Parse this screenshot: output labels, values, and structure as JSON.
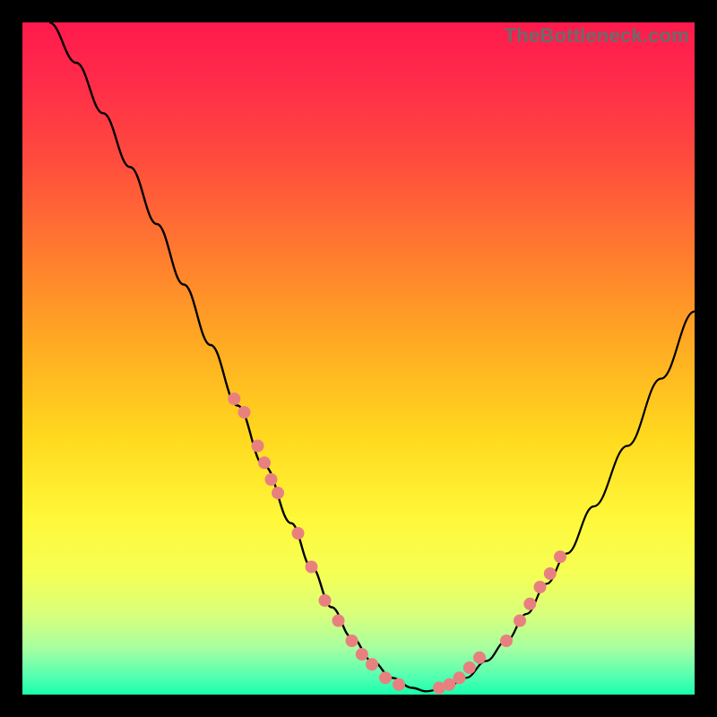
{
  "watermark": "TheBottleneck.com",
  "colors": {
    "bg": "#000000",
    "gradient_top": "#ff1a4d",
    "gradient_bottom": "#19ffad",
    "curve": "#000000",
    "marker": "#e98080"
  },
  "chart_data": {
    "type": "line",
    "title": "",
    "xlabel": "",
    "ylabel": "",
    "xlim": [
      0,
      100
    ],
    "ylim": [
      0,
      100
    ],
    "grid": false,
    "legend": false,
    "series": [
      {
        "name": "left-curve",
        "x": [
          4,
          8,
          12,
          16,
          20,
          24,
          28,
          32,
          36,
          40,
          43,
          46,
          49,
          52,
          55,
          58,
          60
        ],
        "values": [
          100,
          94,
          86.5,
          78.5,
          70,
          61,
          52,
          43,
          34,
          25.5,
          19,
          13,
          8.5,
          5,
          2.5,
          1,
          0.5
        ]
      },
      {
        "name": "right-curve",
        "x": [
          60,
          63,
          66,
          69,
          72,
          75,
          78,
          81,
          85,
          90,
          95,
          100
        ],
        "values": [
          0.5,
          1,
          2.5,
          5,
          8,
          12,
          16.5,
          21,
          28,
          37,
          47,
          57
        ]
      },
      {
        "name": "markers-left",
        "x": [
          31.5,
          33,
          35,
          36,
          37,
          38,
          41,
          43,
          45,
          47,
          49,
          50.5,
          52,
          54,
          56
        ],
        "values": [
          44,
          42,
          37,
          34.5,
          32,
          30,
          24,
          19,
          14,
          11,
          8,
          6,
          4.5,
          2.5,
          1.5
        ]
      },
      {
        "name": "markers-right",
        "x": [
          62,
          63.5,
          65,
          66.5,
          68,
          72,
          74,
          75.5,
          77,
          78.5,
          80
        ],
        "values": [
          1,
          1.5,
          2.5,
          4,
          5.5,
          8,
          11,
          13.5,
          16,
          18,
          20.5
        ]
      }
    ]
  }
}
